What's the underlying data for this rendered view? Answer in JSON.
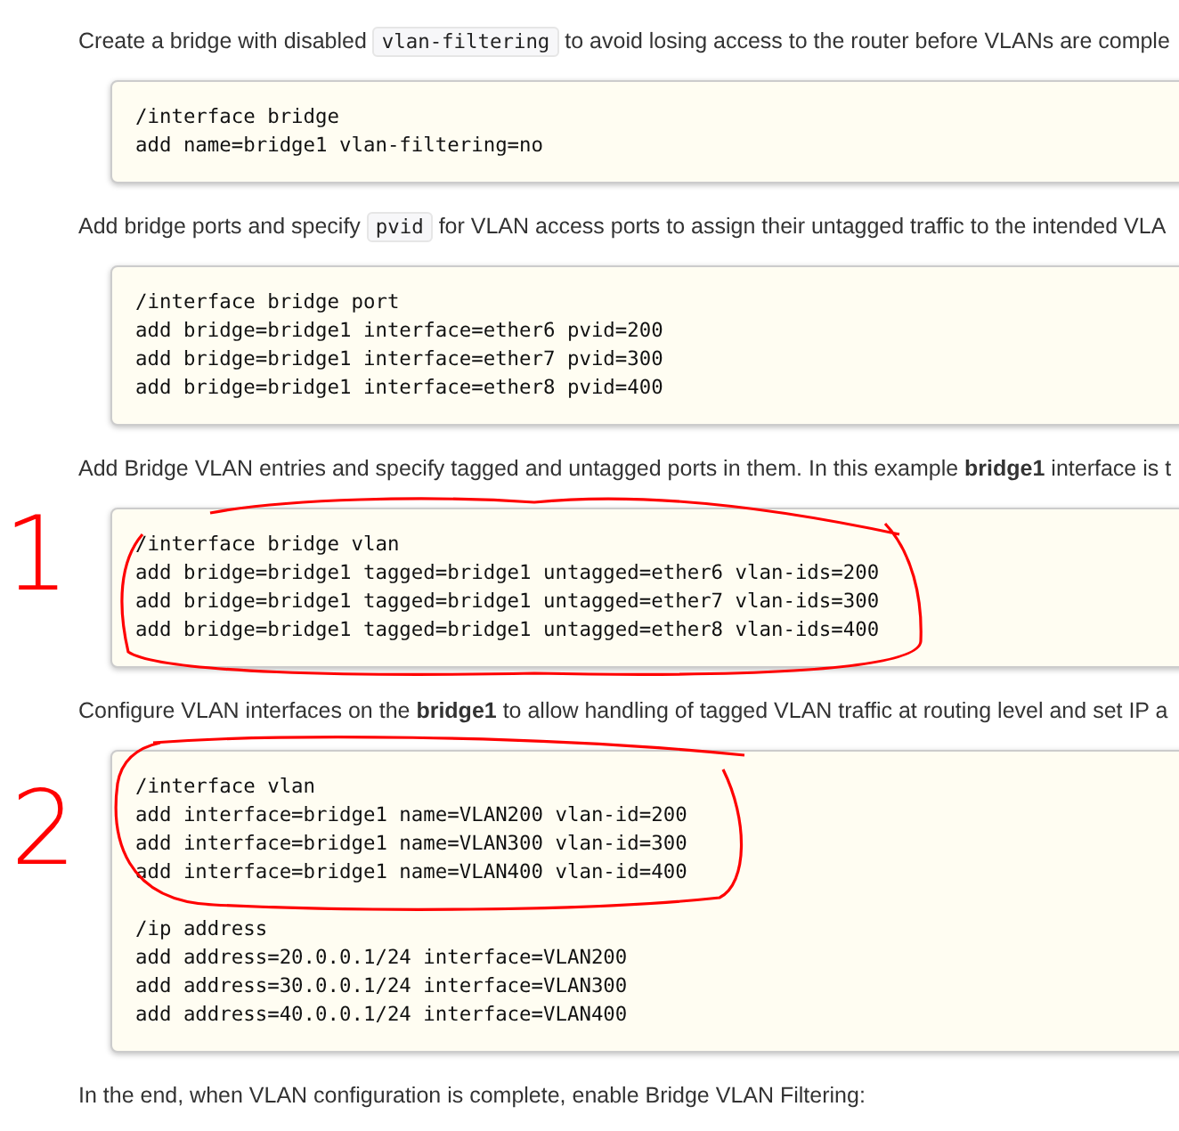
{
  "content": [
    {
      "kind": "paragraph",
      "segments": [
        {
          "kind": "text",
          "text": "Create a bridge with disabled "
        },
        {
          "kind": "code",
          "text": "vlan-filtering"
        },
        {
          "kind": "text",
          "text": " to avoid losing access to the router before VLANs are comple"
        }
      ]
    },
    {
      "kind": "code",
      "sections": [
        [
          "/interface bridge",
          "add name=bridge1 vlan-filtering=no"
        ]
      ]
    },
    {
      "kind": "paragraph",
      "segments": [
        {
          "kind": "text",
          "text": "Add bridge ports and specify "
        },
        {
          "kind": "code",
          "text": "pvid"
        },
        {
          "kind": "text",
          "text": " for VLAN access ports to assign their untagged traffic to the intended VLA"
        }
      ]
    },
    {
      "kind": "code",
      "sections": [
        [
          "/interface bridge port",
          "add bridge=bridge1 interface=ether6 pvid=200",
          "add bridge=bridge1 interface=ether7 pvid=300",
          "add bridge=bridge1 interface=ether8 pvid=400"
        ]
      ]
    },
    {
      "kind": "paragraph",
      "segments": [
        {
          "kind": "text",
          "text": "Add Bridge VLAN entries and specify tagged and untagged ports in them. In this example **bridge1** interface is t"
        }
      ]
    },
    {
      "kind": "code",
      "sections": [
        [
          "/interface bridge vlan",
          "add bridge=bridge1 tagged=bridge1 untagged=ether6 vlan-ids=200",
          "add bridge=bridge1 tagged=bridge1 untagged=ether7 vlan-ids=300",
          "add bridge=bridge1 tagged=bridge1 untagged=ether8 vlan-ids=400"
        ]
      ]
    },
    {
      "kind": "paragraph",
      "segments": [
        {
          "kind": "text",
          "text": "Configure VLAN interfaces on the **bridge1** to allow handling of tagged VLAN traffic at routing level and set IP a"
        }
      ]
    },
    {
      "kind": "code",
      "sections": [
        [
          "/interface vlan",
          "add interface=bridge1 name=VLAN200 vlan-id=200",
          "add interface=bridge1 name=VLAN300 vlan-id=300",
          "add interface=bridge1 name=VLAN400 vlan-id=400"
        ],
        [
          "/ip address",
          "add address=20.0.0.1/24 interface=VLAN200",
          "add address=30.0.0.1/24 interface=VLAN300",
          "add address=40.0.0.1/24 interface=VLAN400"
        ]
      ]
    },
    {
      "kind": "paragraph",
      "segments": [
        {
          "kind": "text",
          "text": "In the end, when VLAN configuration is complete, enable Bridge VLAN Filtering:"
        }
      ]
    }
  ],
  "annotations": [
    {
      "label": "1"
    },
    {
      "label": "2"
    }
  ]
}
